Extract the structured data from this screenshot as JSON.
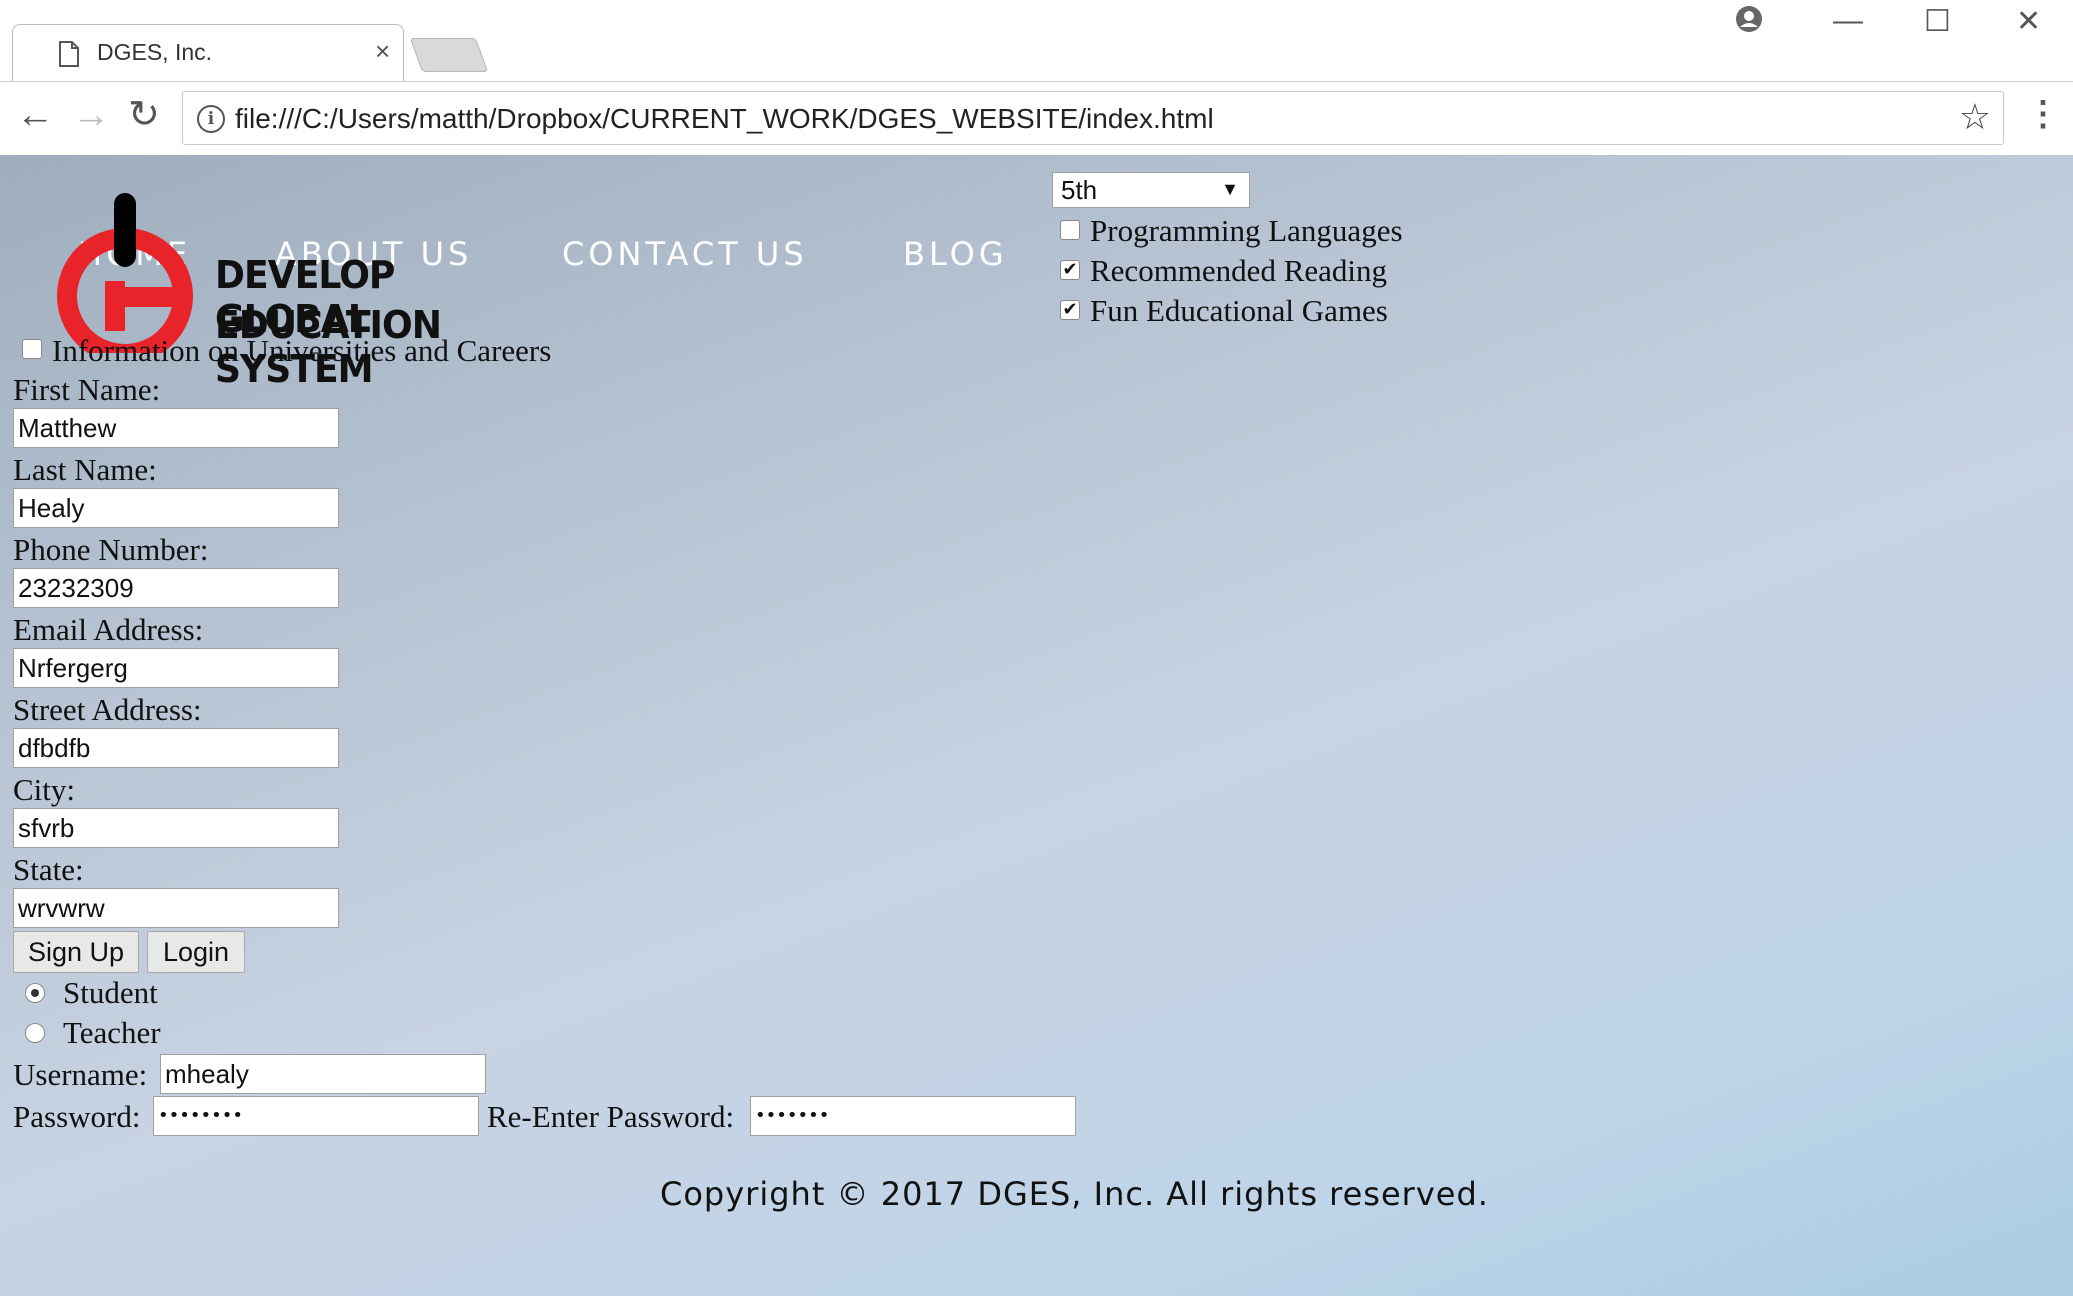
{
  "browser": {
    "tab_title": "DGES, Inc.",
    "tab_close": "×",
    "url": "file:///C:/Users/matth/Dropbox/CURRENT_WORK/DGES_WEBSITE/index.html",
    "back": "←",
    "forward": "→",
    "reload": "↻",
    "star": "☆",
    "menu": "⋮",
    "minimize": "—",
    "maximize": "☐",
    "close": "✕",
    "info": "i"
  },
  "nav": {
    "home": "HOME",
    "about": "ABOUT US",
    "contact": "CONTACT US",
    "blog": "BLOG"
  },
  "logo": {
    "line1": "DEVELOP GLOBAL",
    "line2": "EDUCATION SYSTEM",
    "brand_red": "#e8232a"
  },
  "grade": {
    "selected": "5th",
    "arrow": "▼"
  },
  "interests": [
    {
      "label": "Programming Languages",
      "checked": false,
      "mark": ""
    },
    {
      "label": "Recommended Reading",
      "checked": true,
      "mark": "✔"
    },
    {
      "label": "Fun Educational Games",
      "checked": true,
      "mark": "✔"
    },
    {
      "label": "Information on Universities and Careers",
      "checked": false,
      "mark": ""
    }
  ],
  "form": {
    "first_name_label": "First Name:",
    "first_name": "Matthew",
    "last_name_label": "Last Name:",
    "last_name": "Healy",
    "phone_label": "Phone Number:",
    "phone": "23232309",
    "email_label": "Email Address:",
    "email": "Nrfergerg",
    "street_label": "Street Address:",
    "street": "dfbdfb",
    "city_label": "City:",
    "city": "sfvrb",
    "state_label": "State:",
    "state": "wrvwrw",
    "signup": "Sign Up",
    "login": "Login",
    "role_student": "Student",
    "role_teacher": "Teacher",
    "username_label": "Username:",
    "username": "mhealy",
    "password_label": "Password:",
    "password": "••••••••",
    "reenter_label": "Re-Enter Password:",
    "reenter": "•••••••"
  },
  "footer": {
    "copyright": "Copyright © 2017 DGES, Inc. All rights reserved."
  }
}
